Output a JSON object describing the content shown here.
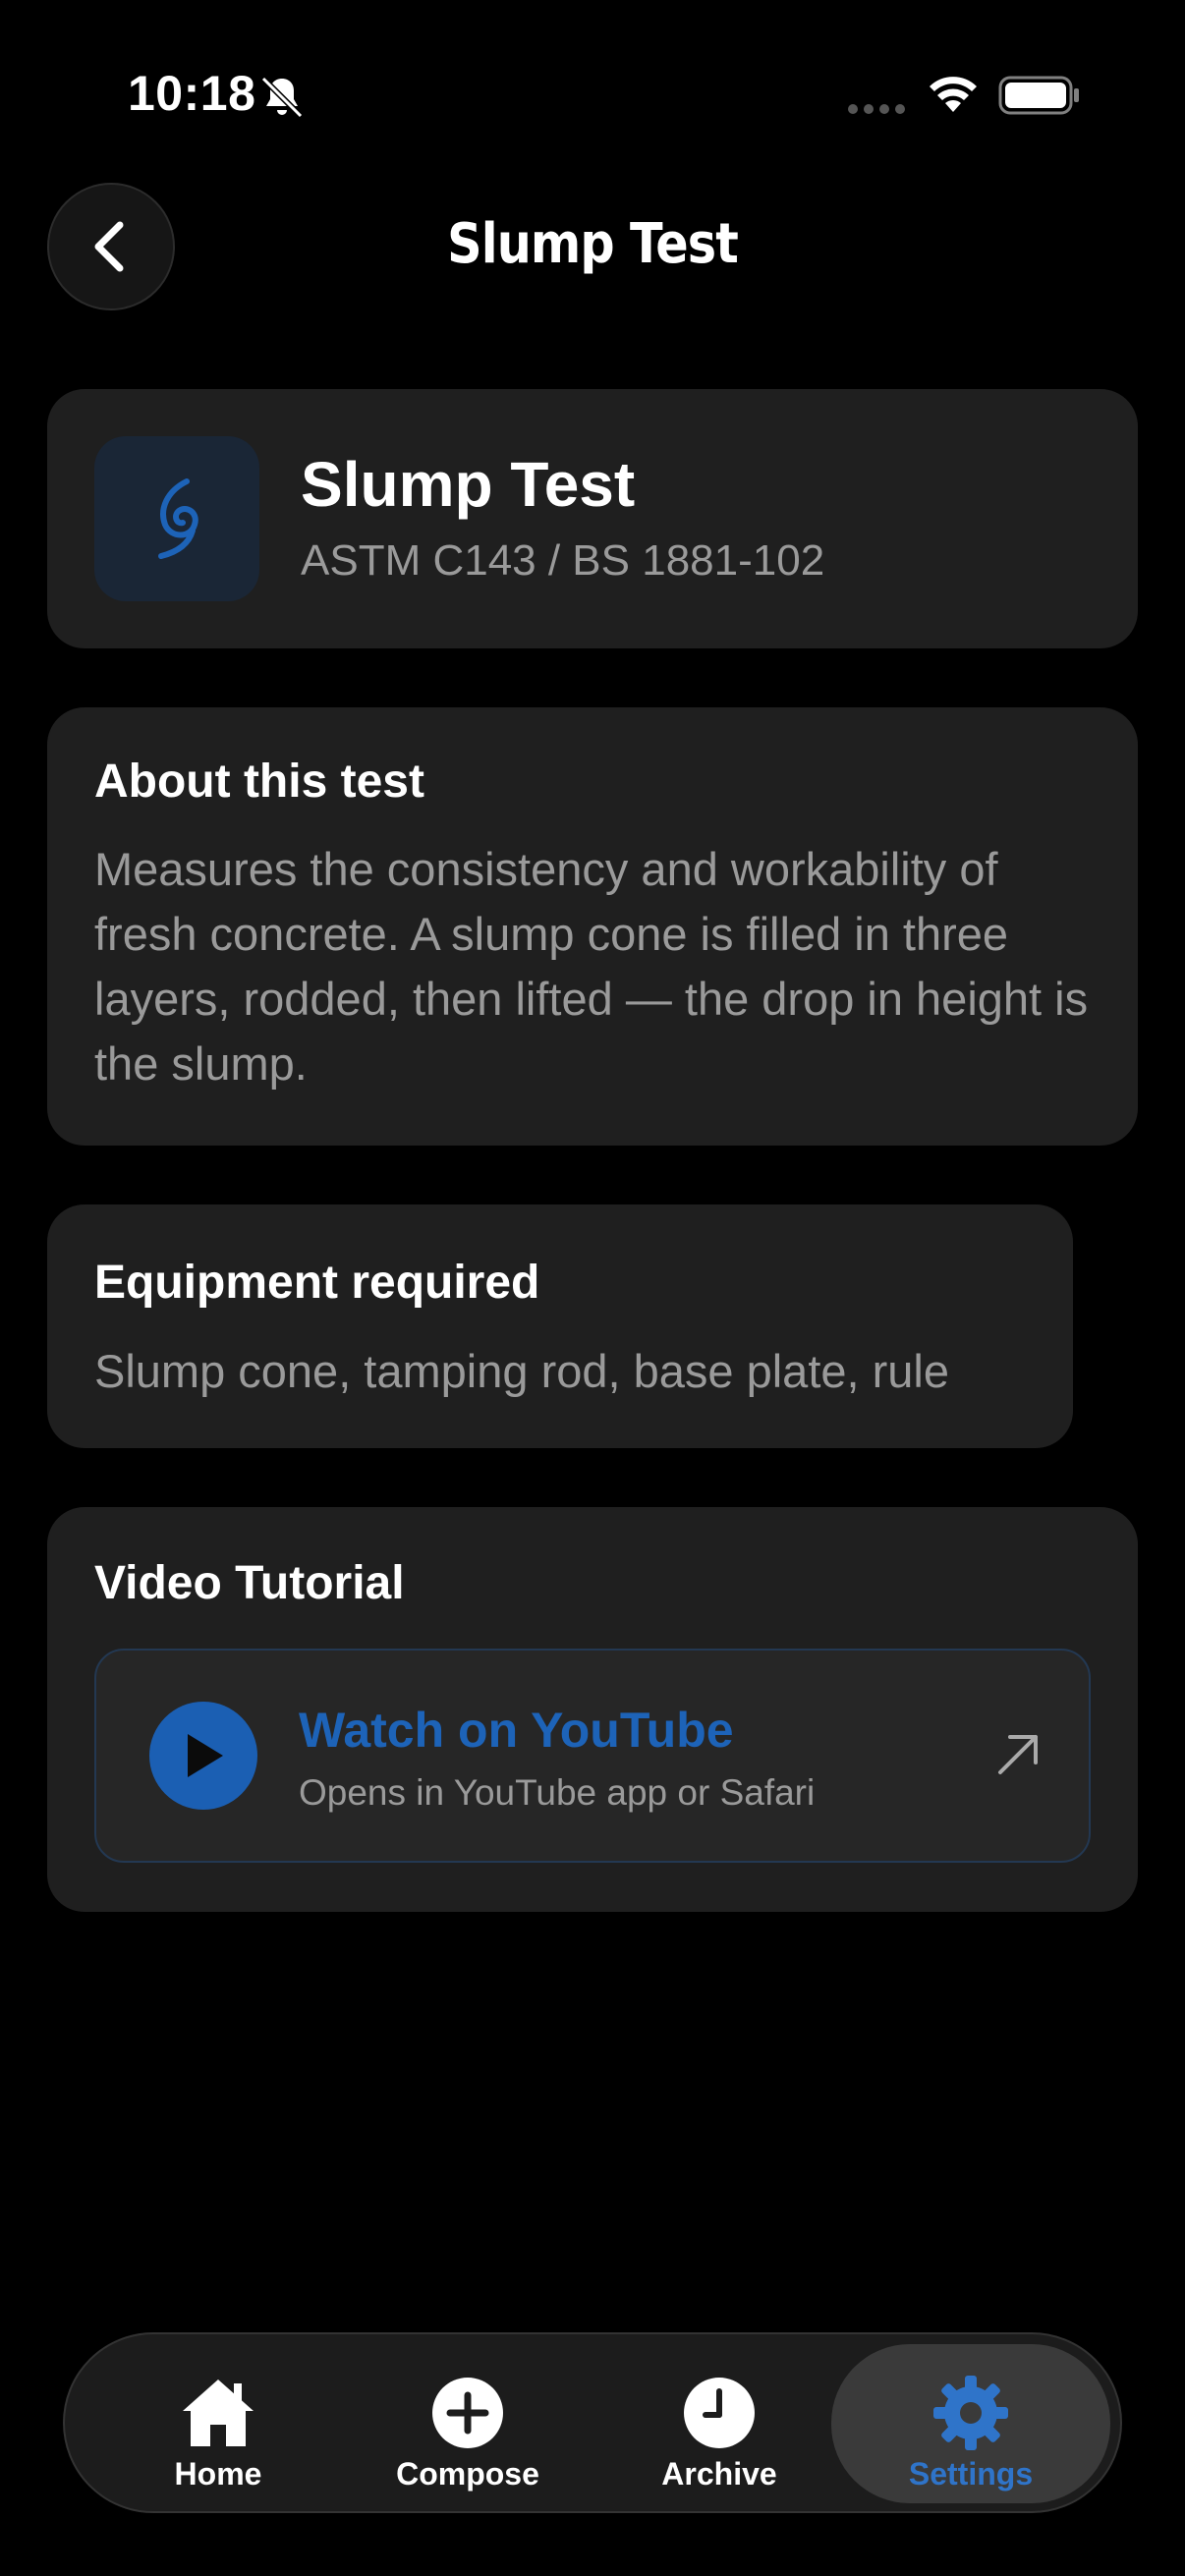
{
  "status_bar": {
    "time": "10:18"
  },
  "nav": {
    "title": "Slump Test"
  },
  "header": {
    "title": "Slump Test",
    "standard": "ASTM C143 / BS 1881-102",
    "icon": "swirl-icon"
  },
  "about": {
    "heading": "About this test",
    "body": "Measures the consistency and workability of fresh concrete. A slump cone is filled in three layers, rodded, then lifted — the drop in height is the slump."
  },
  "equipment": {
    "heading": "Equipment required",
    "body": "Slump cone, tamping rod, base plate, rule"
  },
  "video": {
    "heading": "Video Tutorial",
    "button_title": "Watch on YouTube",
    "button_subtitle": "Opens in YouTube app or Safari"
  },
  "tabs": [
    {
      "label": "Home",
      "icon": "house-icon"
    },
    {
      "label": "Compose",
      "icon": "plus-circle-icon"
    },
    {
      "label": "Archive",
      "icon": "clock-icon"
    },
    {
      "label": "Settings",
      "icon": "gear-icon",
      "active": true
    }
  ],
  "colors": {
    "accent": "#1d63b8",
    "background": "#000000",
    "card": "#1f1f1f"
  }
}
